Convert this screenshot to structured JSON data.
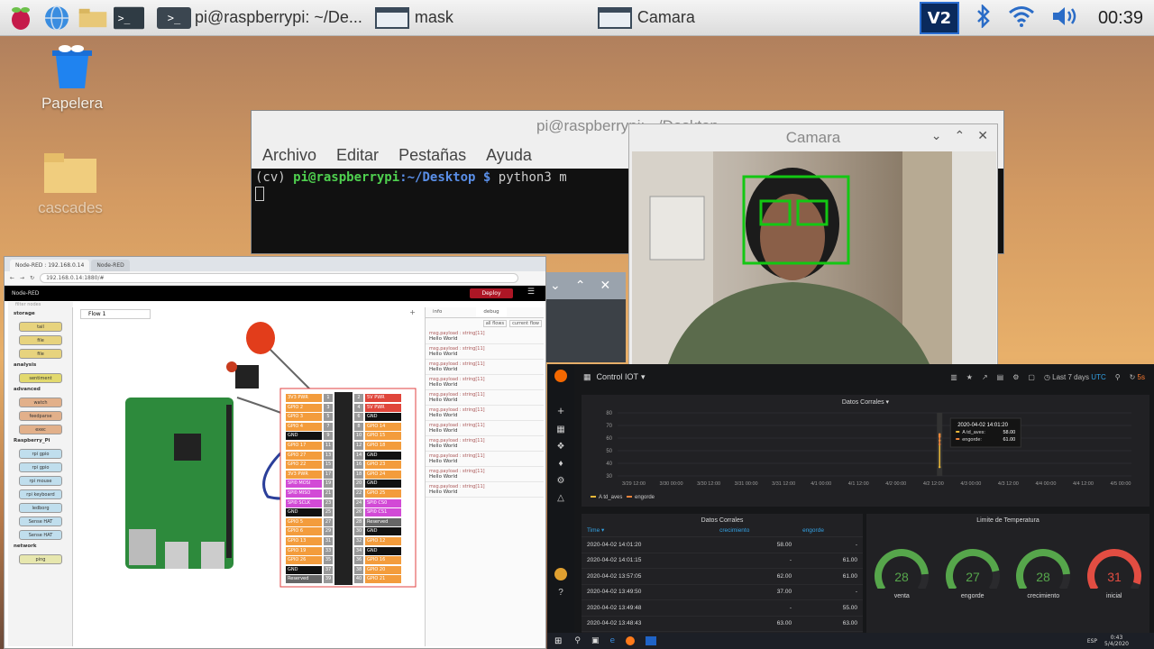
{
  "taskbar": {
    "tasks": [
      {
        "label": "pi@raspberrypi: ~/De..."
      },
      {
        "label": "mask"
      },
      {
        "label": "Camara"
      }
    ],
    "clock": "00:39",
    "vnc_label": "V2"
  },
  "desktop": {
    "icons": [
      {
        "label": "Papelera"
      },
      {
        "label": "cascades"
      }
    ]
  },
  "terminal": {
    "title": "pi@raspberrypi: ~/Desktop",
    "menu": [
      "Archivo",
      "Editar",
      "Pestañas",
      "Ayuda"
    ],
    "env": "(cv)",
    "prompt_user": "pi@raspberrypi",
    "prompt_path": ":~/Desktop $",
    "command": "python3 m"
  },
  "camera": {
    "title": "Camara"
  },
  "nodered": {
    "tabs": [
      "Node-RED : 192.168.0.14",
      "Node-RED"
    ],
    "url": "192.168.0.14:1880/#",
    "app_name": "Node-RED",
    "deploy_label": "Deploy",
    "filter_placeholder": "filter nodes",
    "flow_tab": "Flow 1",
    "side_tabs": [
      "info",
      "debug"
    ],
    "debug_buttons": [
      "all flows",
      "current flow"
    ],
    "palette": [
      {
        "category": "storage",
        "nodes": [
          "tail",
          "file",
          "file"
        ],
        "color": "#e7d37e"
      },
      {
        "category": "analysis",
        "nodes": [
          "sentiment"
        ],
        "color": "#e2d96e"
      },
      {
        "category": "advanced",
        "nodes": [
          "watch",
          "feedparse",
          "exec"
        ],
        "color": "#e2b08a"
      },
      {
        "category": "Raspberry_Pi",
        "nodes": [
          "rpi gpio",
          "rpi gpio",
          "rpi mouse",
          "rpi keyboard",
          "ledborg",
          "Sense HAT",
          "Sense HAT"
        ],
        "color": "#c0deed"
      },
      {
        "category": "network",
        "nodes": [
          "ping"
        ],
        "color": "#e7e7ae"
      }
    ],
    "debug_messages": [
      {
        "meta": "msg.payload : string[11]",
        "value": "Hello World"
      },
      {
        "meta": "msg.payload : string[11]",
        "value": "Hello World"
      },
      {
        "meta": "msg.payload : string[11]",
        "value": "Hello World"
      },
      {
        "meta": "msg.payload : string[11]",
        "value": "Hello World"
      },
      {
        "meta": "msg.payload : string[11]",
        "value": "Hello World"
      },
      {
        "meta": "msg.payload : string[11]",
        "value": "Hello World"
      },
      {
        "meta": "msg.payload : string[11]",
        "value": "Hello World"
      },
      {
        "meta": "msg.payload : string[11]",
        "value": "Hello World"
      },
      {
        "meta": "msg.payload : string[11]",
        "value": "Hello World"
      },
      {
        "meta": "msg.payload : string[11]",
        "value": "Hello World"
      },
      {
        "meta": "msg.payload : string[11]",
        "value": "Hello World"
      }
    ],
    "gpio_left": [
      "3V3 PWR",
      "GPIO 2",
      "GPIO 3",
      "GPIO 4",
      "GND",
      "GPIO 17",
      "GPIO 27",
      "GPIO 22",
      "3V3 PWR",
      "SPI0 MOSI",
      "SPI0 MISO",
      "SPI0 SCLK",
      "GND",
      "GPIO 5",
      "GPIO 6",
      "GPIO 13",
      "GPIO 19",
      "GPIO 26",
      "GND",
      "Reserved"
    ],
    "gpio_right": [
      "5V PWR",
      "5V PWR",
      "GND",
      "GPIO 14",
      "GPIO 15",
      "GPIO 18",
      "GND",
      "GPIO 23",
      "GPIO 24",
      "GND",
      "GPIO 25",
      "SPI0 CS0",
      "SPI0 CS1",
      "Reserved",
      "GND",
      "GPIO 12",
      "GND",
      "GPIO 16",
      "GPIO 20",
      "GPIO 21"
    ]
  },
  "grafana": {
    "dashboard_title": "Control IOT",
    "time_range": "Last 7 days",
    "time_zone": "UTC",
    "refresh": "5s",
    "graph": {
      "title": "Datos Corrales",
      "tooltip": {
        "time": "2020-04-02 14:01:20",
        "rows": [
          {
            "name": "A td_aves:",
            "value": "58.00"
          },
          {
            "name": "engorde:",
            "value": "61.00"
          }
        ]
      },
      "legend": [
        "A td_aves",
        "engorde"
      ]
    },
    "table": {
      "title": "Datos Corrales",
      "columns": [
        "Time",
        "crecimiento",
        "engorde"
      ],
      "rows": [
        [
          "2020-04-02 14:01:20",
          "58.00",
          "-"
        ],
        [
          "2020-04-02 14:01:15",
          "-",
          "61.00"
        ],
        [
          "2020-04-02 13:57:05",
          "62.00",
          "61.00"
        ],
        [
          "2020-04-02 13:49:50",
          "37.00",
          "-"
        ],
        [
          "2020-04-02 13:49:48",
          "-",
          "55.00"
        ],
        [
          "2020-04-02 13:48:43",
          "63.00",
          "63.00"
        ]
      ]
    },
    "gauges_title": "Limite de Temperatura",
    "gauges": [
      {
        "label": "venta",
        "value": "28",
        "level": 0.28,
        "color": "#56a64b"
      },
      {
        "label": "engorde",
        "value": "27",
        "level": 0.27,
        "color": "#56a64b"
      },
      {
        "label": "crecimiento",
        "value": "28",
        "level": 0.28,
        "color": "#56a64b"
      },
      {
        "label": "inicial",
        "value": "31",
        "level": 0.31,
        "color": "#e24d42"
      }
    ]
  },
  "windows_taskbar": {
    "time": "0:43",
    "date": "5/4/2020",
    "lang": "ESP"
  },
  "chart_data": {
    "type": "line",
    "title": "Datos Corrales",
    "x": [
      "3/29 12:00",
      "3/30 00:00",
      "3/30 12:00",
      "3/31 00:00",
      "3/31 12:00",
      "4/1 00:00",
      "4/1 12:00",
      "4/2 00:00",
      "4/2 12:00",
      "4/3 00:00",
      "4/3 12:00",
      "4/4 00:00",
      "4/4 12:00",
      "4/5 00:00"
    ],
    "yticks": [
      "30",
      "40",
      "50",
      "60",
      "70",
      "80"
    ],
    "ylim": [
      30,
      80
    ],
    "series": [
      {
        "name": "A td_aves",
        "color": "#eab839",
        "points": [
          {
            "x": "4/2 14:01",
            "y": 58
          },
          {
            "x": "4/2 13:57",
            "y": 62
          },
          {
            "x": "4/2 13:49",
            "y": 37
          },
          {
            "x": "4/2 13:48",
            "y": 63
          }
        ]
      },
      {
        "name": "engorde",
        "color": "#ef843c",
        "points": [
          {
            "x": "4/2 14:01",
            "y": 61
          },
          {
            "x": "4/2 13:57",
            "y": 61
          },
          {
            "x": "4/2 13:49",
            "y": 55
          },
          {
            "x": "4/2 13:48",
            "y": 63
          }
        ]
      }
    ],
    "legend": "bottom-left",
    "grid": true
  }
}
